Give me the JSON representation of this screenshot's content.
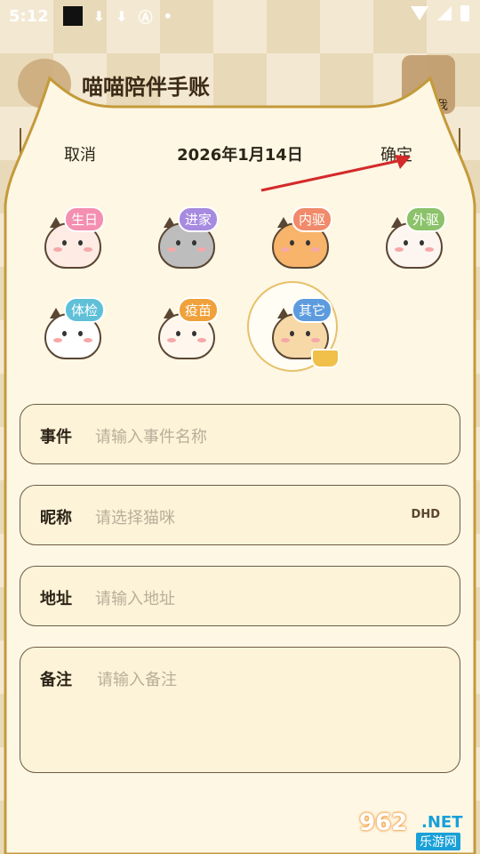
{
  "status_bar": {
    "time": "5:12"
  },
  "app": {
    "title": "喵喵陪伴手账",
    "me_label": "我"
  },
  "toolbar": {
    "cancel_label": "取消",
    "date": "2026年1月14日",
    "confirm_label": "确定"
  },
  "categories": [
    {
      "label": "生日",
      "tag_color": "#f48fb1",
      "cat_color": "#fdebe4"
    },
    {
      "label": "进家",
      "tag_color": "#a78be0",
      "cat_color": "#bdbdbd"
    },
    {
      "label": "内驱",
      "tag_color": "#f08a6a",
      "cat_color": "#f7b46a"
    },
    {
      "label": "外驱",
      "tag_color": "#8cc26a",
      "cat_color": "#fdf6f0"
    },
    {
      "label": "体检",
      "tag_color": "#5fc0d8",
      "cat_color": "#ffffff"
    },
    {
      "label": "疫苗",
      "tag_color": "#f0a13a",
      "cat_color": "#fff7ee"
    },
    {
      "label": "其它",
      "tag_color": "#5c9bde",
      "cat_color": "#f7d9a8",
      "selected": true
    }
  ],
  "form": {
    "event": {
      "label": "事件",
      "placeholder": "请输入事件名称"
    },
    "nickname": {
      "label": "昵称",
      "placeholder": "请选择猫咪",
      "suffix": "DHD"
    },
    "address": {
      "label": "地址",
      "placeholder": "请输入地址"
    },
    "note": {
      "label": "备注",
      "placeholder": "请输入备注"
    }
  },
  "watermark": {
    "number": "962",
    "net": ".NET",
    "text": "乐游网"
  },
  "colors": {
    "panel": "#fdf7e4",
    "border": "#c49a3a",
    "accent_arrow": "#d42a2a"
  }
}
